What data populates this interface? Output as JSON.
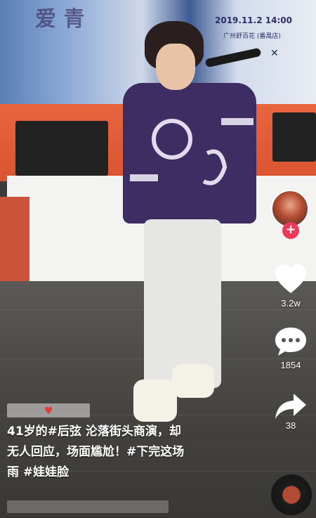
{
  "video": {
    "banner_date": "2019.11.2 14:00",
    "banner_venue": "广州舒百花 (番禺店)"
  },
  "side_actions": {
    "likes": {
      "icon": "heart-icon",
      "count": "3.2w"
    },
    "comments": {
      "icon": "comment-icon",
      "count": "1854"
    },
    "shares": {
      "icon": "share-icon",
      "count": "38"
    },
    "follow_icon": "plus-icon"
  },
  "caption": {
    "line1_prefix": "41岁的",
    "tag1": "#后弦",
    "line1_rest": " 沦落街头商演，却",
    "line2": "无人回应，场面尴尬！",
    "tag2": "#下完这场",
    "line3_tag": "雨",
    "tag3": "#娃娃脸"
  },
  "colors": {
    "follow_badge": "#f2385a",
    "stage": "#e9653e",
    "shirt": "#3d2d63"
  }
}
